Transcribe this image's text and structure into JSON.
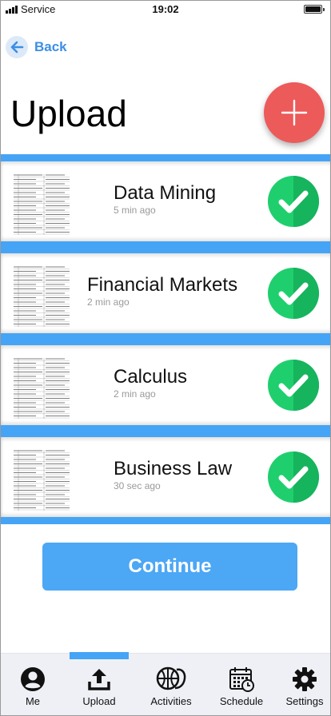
{
  "status_bar": {
    "carrier": "Service",
    "time": "19:02"
  },
  "header": {
    "back_label": "Back",
    "title": "Upload"
  },
  "colors": {
    "accent": "#45a4f5",
    "fab": "#ec5a5a",
    "success": "#1fcf6e",
    "success_dark": "#16b45d"
  },
  "uploads": [
    {
      "course": "Data Mining",
      "time_ago": "5 min ago",
      "status_icon": "check-circle-icon"
    },
    {
      "course": "Financial Markets",
      "time_ago": "2 min ago",
      "status_icon": "check-circle-icon"
    },
    {
      "course": "Calculus",
      "time_ago": "2 min ago",
      "status_icon": "check-circle-icon"
    },
    {
      "course": "Business Law",
      "time_ago": "30 sec ago",
      "status_icon": "check-circle-icon"
    }
  ],
  "continue_label": "Continue",
  "tabbar": {
    "active": "Upload",
    "items": [
      {
        "label": "Me",
        "icon": "user-icon"
      },
      {
        "label": "Upload",
        "icon": "upload-icon"
      },
      {
        "label": "Activities",
        "icon": "activities-icon"
      },
      {
        "label": "Schedule",
        "icon": "calendar-icon"
      },
      {
        "label": "Settings",
        "icon": "gear-icon"
      }
    ]
  }
}
